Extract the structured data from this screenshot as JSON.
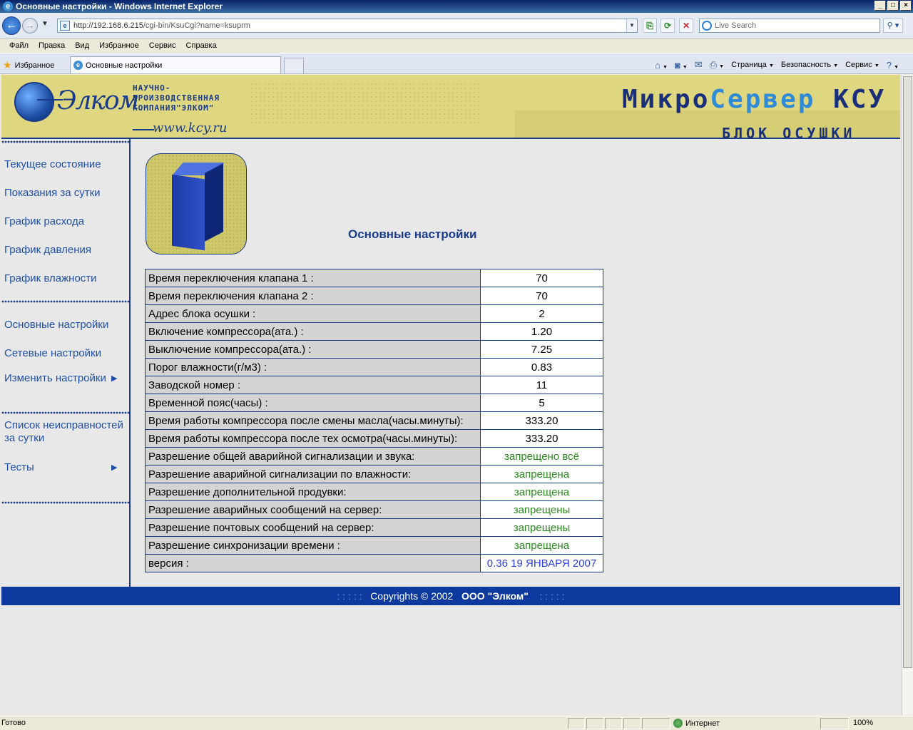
{
  "window": {
    "title": "Основные настройки - Windows Internet Explorer"
  },
  "address": {
    "url_host": "http://192.168.6.215",
    "url_path": "/cgi-bin/KsuCgi?name=ksuprm"
  },
  "search": {
    "placeholder": "Live Search"
  },
  "menu": [
    "Файл",
    "Правка",
    "Вид",
    "Избранное",
    "Сервис",
    "Справка"
  ],
  "tabs": {
    "favorites_label": "Избранное",
    "active_tab": "Основные настройки"
  },
  "command_bar": {
    "page": "Страница",
    "safety": "Безопасность",
    "tools": "Сервис"
  },
  "header": {
    "logo_text": "Элком",
    "company_line1": "научно-",
    "company_line2": "производственная",
    "company_line3": "компания\"элком\"",
    "website": "www.kcy.ru",
    "product_part1": "Микро",
    "product_part2": "Сервер",
    "product_part3": " КСУ",
    "unit_name": "БЛОК ОСУШКИ"
  },
  "sidebar": {
    "group1": [
      "Текущее состояние",
      "Показания за сутки",
      "График расхода",
      "График давления",
      "График влажности"
    ],
    "group2": [
      "Основные настройки",
      "Сетевые настройки",
      "Изменить настройки"
    ],
    "group3_line1": "Список неисправностей",
    "group3_line2": "за сутки",
    "tests": "Тесты"
  },
  "content": {
    "heading": "Основные настройки",
    "rows": [
      {
        "label": "Время переключения клапана 1 :",
        "value": "70"
      },
      {
        "label": "Время переключения клапана 2 :",
        "value": "70"
      },
      {
        "label": "Адрес блока осушки :",
        "value": "2"
      },
      {
        "label": "Включение компрессора(ата.) :",
        "value": "1.20"
      },
      {
        "label": "Выключение компрессора(ата.) :",
        "value": "7.25"
      },
      {
        "label": "Порог влажности(г/м3) :",
        "value": "0.83"
      },
      {
        "label": "Заводской номер :",
        "value": "11"
      },
      {
        "label": "Временной пояс(часы) :",
        "value": "5"
      },
      {
        "label": "Время работы компрессора после смены масла(часы.минуты):",
        "value": "333.20"
      },
      {
        "label": "Время работы компрессора после тех осмотра(часы.минуты):",
        "value": "333.20"
      },
      {
        "label": "Разрешение общей аварийной сигнализации и звука:",
        "value": "запрещено всё"
      },
      {
        "label": "Разрешение аварийной сигнализации по влажности:",
        "value": "запрещена"
      },
      {
        "label": "Разрешение дополнительной продувки:",
        "value": "запрещена"
      },
      {
        "label": "Разрешение аварийных сообщений на сервер:",
        "value": "запрещены"
      },
      {
        "label": "Разрешение почтовых сообщений на сервер:",
        "value": "запрещены"
      },
      {
        "label": "Разрешение синхронизации времени :",
        "value": "запрещена"
      },
      {
        "label": "версия :",
        "value": "0.36 19 ЯНВАРЯ 2007"
      }
    ]
  },
  "footer": {
    "dots": ": : : : :",
    "copyright": "Copyrights  ©  2002",
    "company": "ООО \"Элком\""
  },
  "status": {
    "text": "Готово",
    "zone": "Интернет",
    "zoom": "100%"
  }
}
